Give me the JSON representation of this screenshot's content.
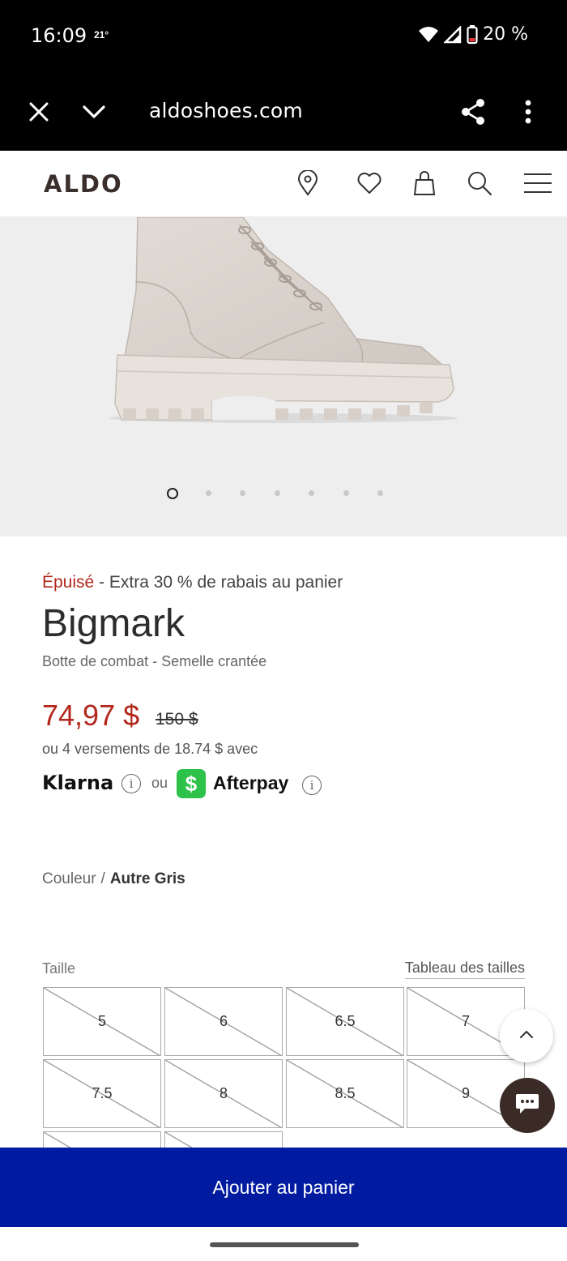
{
  "status_bar": {
    "time": "16:09",
    "temperature": "21°",
    "battery": "20 %",
    "icons": [
      "wifi-icon",
      "cell-signal-icon",
      "battery-icon"
    ]
  },
  "browser": {
    "url": "aldoshoes.com",
    "icons": [
      "close-icon",
      "chevron-down-icon",
      "share-icon",
      "more-vert-icon"
    ]
  },
  "site_header": {
    "logo": "ALDO",
    "icons": [
      "store-locator-icon",
      "heart-icon",
      "bag-icon",
      "search-icon",
      "menu-icon"
    ]
  },
  "gallery": {
    "image": "boot-image",
    "dot_count": 7,
    "active_index": 0
  },
  "product": {
    "stock_status": "Épuisé",
    "separator": " - ",
    "promo": "Extra 30 % de rabais au panier",
    "name": "Bigmark",
    "subtitle": "Botte de combat - Semelle crantée",
    "price": "74,97 $",
    "original_price": "150 $",
    "installments": "ou 4 versements de 18.74 $ avec",
    "klarna": "Klarna",
    "or": "ou",
    "afterpay": "Afterpay",
    "afterpay_symbol": "$",
    "info_symbol": "i"
  },
  "color": {
    "label": "Couleur",
    "separator": "/",
    "value": "Autre Gris"
  },
  "sizes": {
    "label": "Taille",
    "chart_link": "Tableau des tailles",
    "options": [
      "5",
      "6",
      "6.5",
      "7",
      "7.5",
      "8",
      "8.5",
      "9",
      "",
      ""
    ],
    "all_unavailable": true
  },
  "cta": {
    "add_to_cart": "Ajouter au panier"
  },
  "colors": {
    "sold_out_red": "#b3271c",
    "cta_blue": "#001aa0",
    "afterpay_green": "#2ec24a",
    "chat_brown": "#3a2b27"
  }
}
